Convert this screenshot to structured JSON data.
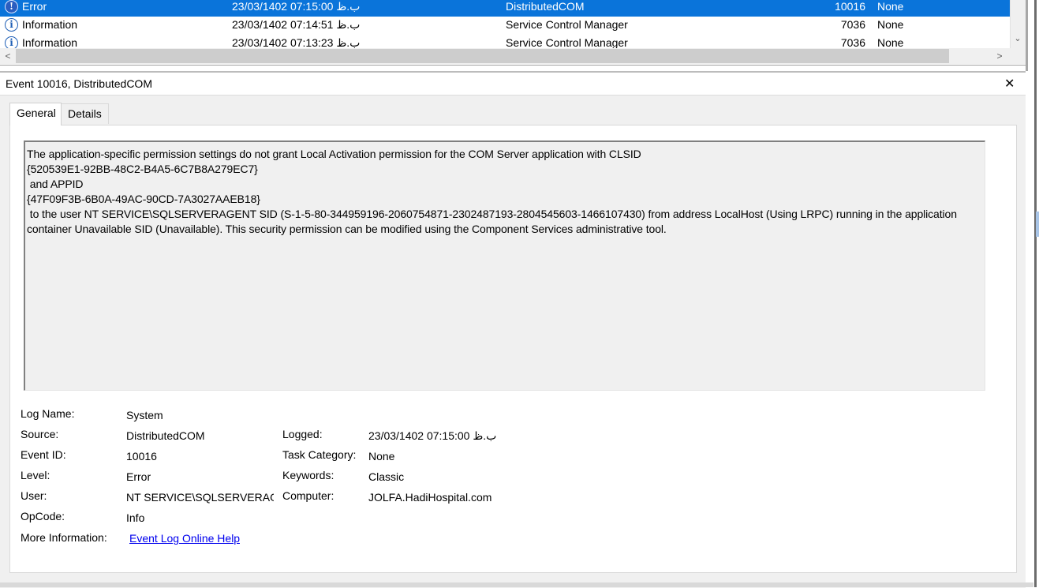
{
  "events": [
    {
      "level": "Error",
      "date": "23/03/1402 07:15:00 ب.ظ",
      "source": "DistributedCOM",
      "event_id": "10016",
      "task_category": "None",
      "selected": true
    },
    {
      "level": "Information",
      "date": "23/03/1402 07:14:51 ب.ظ",
      "source": "Service Control Manager",
      "event_id": "7036",
      "task_category": "None",
      "selected": false
    },
    {
      "level": "Information",
      "date": "23/03/1402 07:13:23 ب.ظ",
      "source": "Service Control Manager",
      "event_id": "7036",
      "task_category": "None",
      "selected": false
    }
  ],
  "icons": {
    "error": "error-icon",
    "information": "information-icon",
    "close": "close-icon"
  },
  "colors": {
    "selection": "#0a74da",
    "link": "#0000ee",
    "pane_bg": "#f0f0f0"
  },
  "detail": {
    "title": "Event 10016, DistributedCOM",
    "close_glyph": "✕",
    "tabs": {
      "general": "General",
      "details": "Details"
    },
    "description": "The application-specific permission settings do not grant Local Activation permission for the COM Server application with CLSID \n{520539E1-92BB-48C2-B4A5-6C7B8A279EC7}\n and APPID \n{47F09F3B-6B0A-49AC-90CD-7A3027AAEB18}\n to the user NT SERVICE\\SQLSERVERAGENT SID (S-1-5-80-344959196-2060754871-2302487193-2804545603-1466107430) from address LocalHost (Using LRPC) running in the application container Unavailable SID (Unavailable). This security permission can be modified using the Component Services administrative tool.",
    "labels": {
      "log_name": "Log Name:",
      "source": "Source:",
      "event_id": "Event ID:",
      "level": "Level:",
      "user": "User:",
      "opcode": "OpCode:",
      "more_info": "More Information:",
      "logged": "Logged:",
      "task_category": "Task Category:",
      "keywords": "Keywords:",
      "computer": "Computer:"
    },
    "values": {
      "log_name": "System",
      "source": "DistributedCOM",
      "event_id": "10016",
      "level": "Error",
      "user": "NT SERVICE\\SQLSERVERAGENT",
      "opcode": "Info",
      "more_info_link": "Event Log Online Help",
      "logged": "23/03/1402 07:15:00 ب.ظ",
      "task_category": "None",
      "keywords": "Classic",
      "computer": "JOLFA.HadiHospital.com"
    }
  },
  "scrollbar": {
    "left_glyph": "<",
    "right_glyph": ">",
    "down_glyph": "⌄"
  }
}
